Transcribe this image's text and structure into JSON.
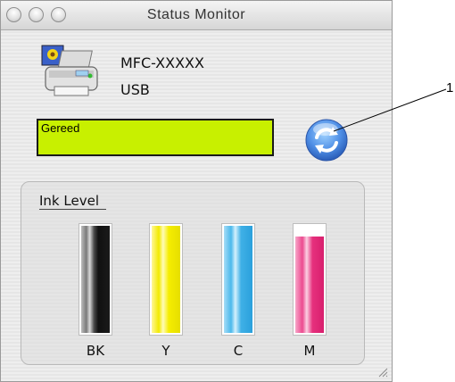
{
  "window": {
    "title": "Status Monitor"
  },
  "device": {
    "model": "MFC-XXXXX",
    "connection": "USB"
  },
  "status": {
    "text": "Gereed",
    "background_color": "#c8f000"
  },
  "ink": {
    "group_title": "Ink Level",
    "cartridges": [
      {
        "label": "BK",
        "level": 1.0,
        "color": "#1a1a1a"
      },
      {
        "label": "Y",
        "level": 1.0,
        "color": "#f5f000"
      },
      {
        "label": "C",
        "level": 1.0,
        "color": "#3fb7ee"
      },
      {
        "label": "M",
        "level": 0.9,
        "color": "#e6307d"
      }
    ]
  },
  "callout": {
    "number": "1"
  },
  "icons": {
    "device": "printer-icon",
    "refresh": "refresh-icon"
  }
}
